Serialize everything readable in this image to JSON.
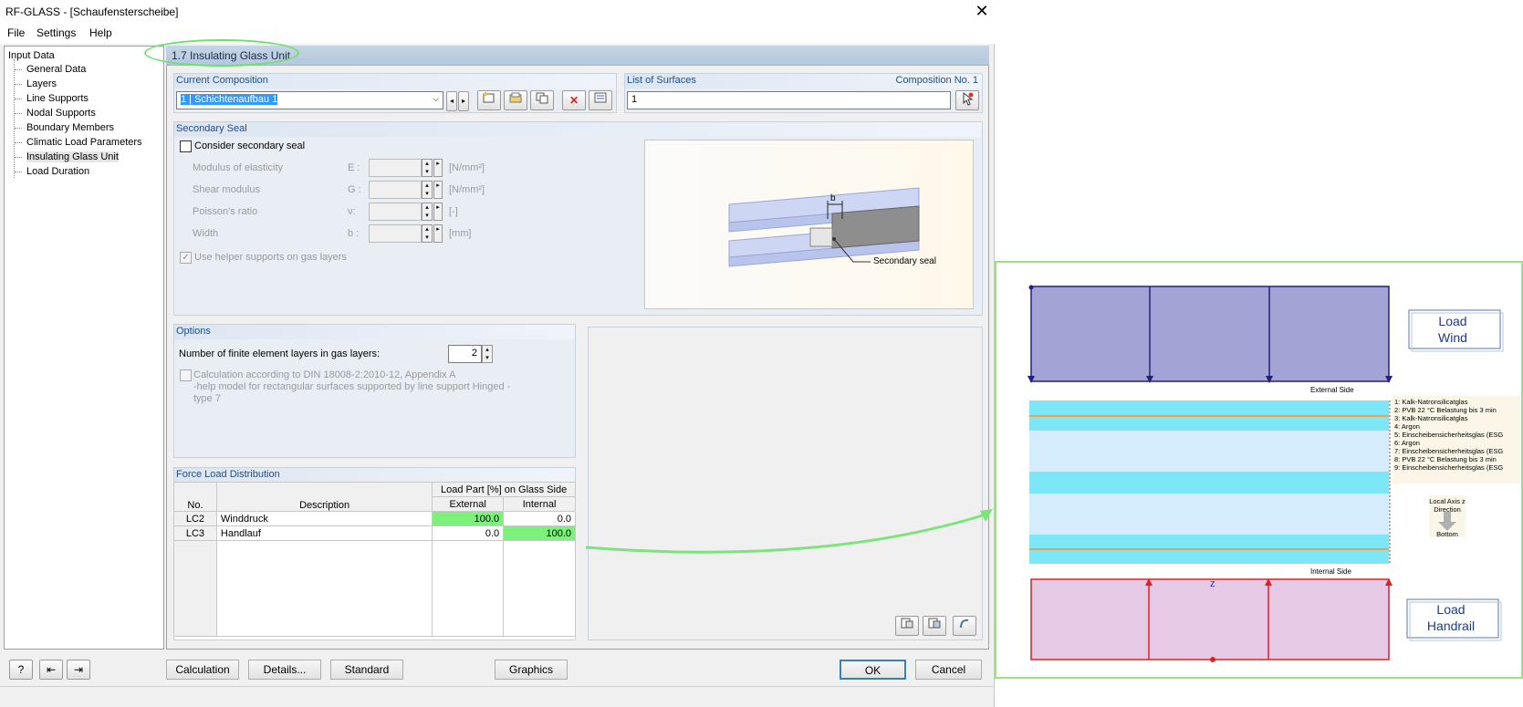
{
  "window": {
    "title": "RF-GLASS - [Schaufensterscheibe]",
    "close": "✕"
  },
  "menu": [
    "File",
    "Settings",
    "Help"
  ],
  "tree": {
    "root": "Input Data",
    "items": [
      "General Data",
      "Layers",
      "Line Supports",
      "Nodal Supports",
      "Boundary Members",
      "Climatic Load Parameters",
      "Insulating Glass Unit",
      "Load Duration"
    ]
  },
  "section_title": "1.7 Insulating Glass Unit",
  "current_composition": {
    "label": "Current Composition",
    "value": "1 | Schichtenaufbau 1"
  },
  "list_of_surfaces": {
    "label": "List of Surfaces",
    "composition_label": "Composition No. 1",
    "value": "1"
  },
  "secondary_seal": {
    "label": "Secondary Seal",
    "consider_label": "Consider secondary seal",
    "rows": [
      {
        "name": "Modulus of elasticity",
        "symbol": "E :",
        "unit": "[N/mm²]"
      },
      {
        "name": "Shear modulus",
        "symbol": "G :",
        "unit": "[N/mm²]"
      },
      {
        "name": "Poisson's ratio",
        "symbol": "ν:",
        "unit": "[-]"
      },
      {
        "name": "Width",
        "symbol": "b :",
        "unit": "[mm]"
      }
    ],
    "helper_label": "Use helper supports on gas layers",
    "figure_label_b": "b",
    "figure_label_seal": "Secondary seal"
  },
  "options": {
    "label": "Options",
    "fe_layers_label": "Number of finite element layers in gas layers:",
    "fe_layers_value": "2",
    "din_line1": "Calculation according to DIN 18008-2:2010-12, Appendix A",
    "din_line2": "-help model for rectangular surfaces supported by line support Hinged -",
    "din_line3": "type 7"
  },
  "force_load": {
    "label": "Force Load Distribution",
    "header_group": "Load Part [%] on Glass Side",
    "col_no": "No.",
    "col_desc": "Description",
    "col_ext": "External",
    "col_int": "Internal",
    "rows": [
      {
        "no": "LC2",
        "desc": "Winddruck",
        "ext": "100.0",
        "int": "0.0"
      },
      {
        "no": "LC3",
        "desc": "Handlauf",
        "ext": "0.0",
        "int": "100.0"
      }
    ]
  },
  "buttons": {
    "calculation": "Calculation",
    "details": "Details...",
    "standard": "Standard",
    "graphics": "Graphics",
    "ok": "OK",
    "cancel": "Cancel"
  },
  "graphic": {
    "load_wind_1": "Load",
    "load_wind_2": "Wind",
    "external_side": "External Side",
    "internal_side": "Internal Side",
    "legend": [
      "1: Kalk-Natronsilicatglas",
      "2: PVB 22 °C Belastung bis 3 min",
      "3: Kalk-Natronsilicatglas",
      "4: Argon",
      "5: Einscheibensicherheitsglas (ESG",
      "6: Argon",
      "7: Einscheibensicherheitsglas (ESG",
      "8: PVB 22 °C Belastung bis 3 min",
      "9: Einscheibensicherheitsglas (ESG"
    ],
    "axis_1": "Local Axis z",
    "axis_2": "Direction",
    "axis_3": "Bottom",
    "z_label": "z",
    "load_handrail_1": "Load",
    "load_handrail_2": "Handrail"
  },
  "colors": {
    "highlight_green": "#7cf27c",
    "glass_cyan": "#7de6f7",
    "gas_blue": "#d4ecfb",
    "wind_fill": "#a3a3d6",
    "handrail_fill": "#e5c9e5"
  }
}
